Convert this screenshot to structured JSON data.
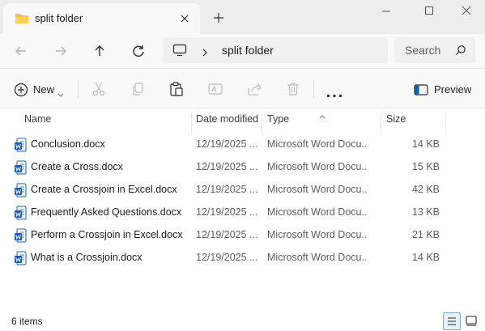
{
  "window": {
    "tab_title": "split folder",
    "icons": {
      "folder": "folder-icon",
      "close_tab": "close-icon",
      "new_tab": "plus-icon",
      "minimize": "minimize-icon",
      "maximize": "maximize-icon",
      "close_window": "close-icon"
    }
  },
  "address": {
    "path_segment": "split folder",
    "search_placeholder": "Search"
  },
  "toolbar": {
    "new_label": "New",
    "preview_label": "Preview"
  },
  "columns": {
    "name": "Name",
    "date_modified": "Date modified",
    "type": "Type",
    "size": "Size"
  },
  "files": [
    {
      "name": "Conclusion.docx",
      "date": "12/19/2025 ...",
      "type": "Microsoft Word Docu...",
      "size": "14 KB"
    },
    {
      "name": "Create a Cross.docx",
      "date": "12/19/2025 ...",
      "type": "Microsoft Word Docu...",
      "size": "15 KB"
    },
    {
      "name": "Create a Crossjoin in Excel.docx",
      "date": "12/19/2025 ...",
      "type": "Microsoft Word Docu...",
      "size": "42 KB"
    },
    {
      "name": "Frequently Asked Questions.docx",
      "date": "12/19/2025 ...",
      "type": "Microsoft Word Docu...",
      "size": "13 KB"
    },
    {
      "name": "Perform a Crossjoin in Excel.docx",
      "date": "12/19/2025 ...",
      "type": "Microsoft Word Docu...",
      "size": "21 KB"
    },
    {
      "name": "What is a Crossjoin.docx",
      "date": "12/19/2025 ...",
      "type": "Microsoft Word Docu...",
      "size": "14 KB"
    }
  ],
  "status": {
    "item_count": "6 items"
  },
  "colors": {
    "accent": "#0067c0",
    "folder_yellow": "#f8c43c",
    "word_blue": "#185abd"
  }
}
